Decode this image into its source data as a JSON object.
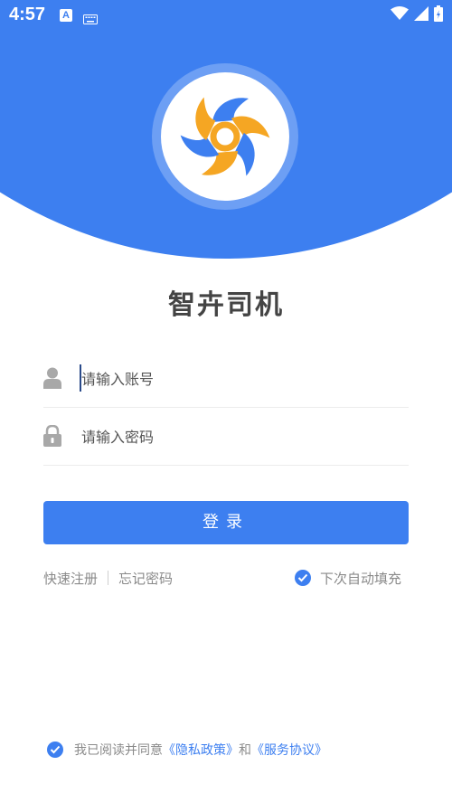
{
  "status_bar": {
    "time": "4:57",
    "a_badge": "A",
    "icons": [
      "keyboard-icon",
      "wifi-icon",
      "signal-icon",
      "battery-icon"
    ]
  },
  "app": {
    "title": "智卉司机"
  },
  "form": {
    "account_placeholder": "请输入账号",
    "password_placeholder": "请输入密码",
    "login_label": "登录"
  },
  "links": {
    "register": "快速注册",
    "forgot_password": "忘记密码",
    "auto_fill": "下次自动填充",
    "auto_fill_checked": true
  },
  "agreement": {
    "prefix": "我已阅读并同意",
    "privacy": "《隐私政策》",
    "and": "和",
    "service": "《服务协议》",
    "checked": true
  },
  "colors": {
    "accent": "#3d7ff0",
    "logo_orange": "#f5a623",
    "logo_blue": "#3d7ff0"
  }
}
